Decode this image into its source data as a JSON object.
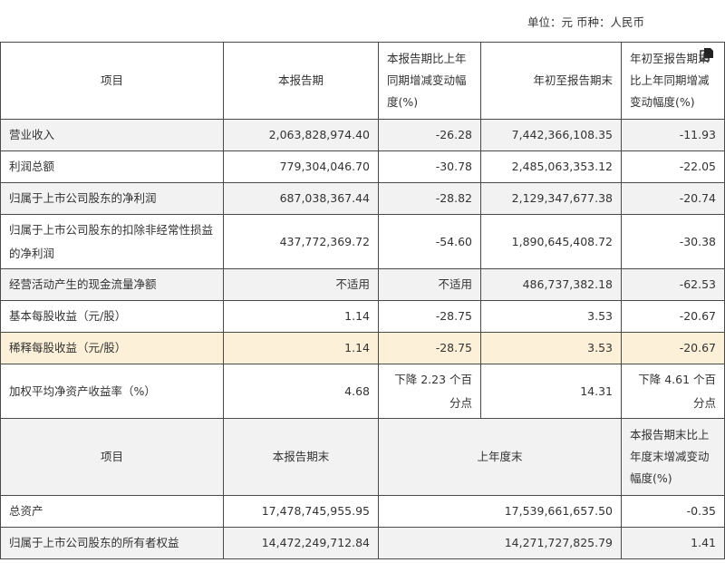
{
  "unit_label": "单位：元 币种：人民币",
  "header1": {
    "item": "项目",
    "current": "本报告期",
    "current_change": "本报告期比上年同期增减变动幅度(%)",
    "ytd": "年初至报告期末",
    "ytd_change": "年初至报告期末比上年同期增减变动幅度(%)"
  },
  "rows": [
    {
      "item": "营业收入",
      "current": "2,063,828,974.40",
      "current_change": "-26.28",
      "ytd": "7,442,366,108.35",
      "ytd_change": "-11.93"
    },
    {
      "item": "利润总额",
      "current": "779,304,046.70",
      "current_change": "-30.78",
      "ytd": "2,485,063,353.12",
      "ytd_change": "-22.05"
    },
    {
      "item": "归属于上市公司股东的净利润",
      "current": "687,038,367.44",
      "current_change": "-28.82",
      "ytd": "2,129,347,677.38",
      "ytd_change": "-20.74"
    },
    {
      "item": "归属于上市公司股东的扣除非经常性损益的净利润",
      "current": "437,772,369.72",
      "current_change": "-54.60",
      "ytd": "1,890,645,408.72",
      "ytd_change": "-30.38"
    },
    {
      "item": "经营活动产生的现金流量净额",
      "current": "不适用",
      "current_change": "不适用",
      "ytd": "486,737,382.18",
      "ytd_change": "-62.53"
    },
    {
      "item": "基本每股收益（元/股）",
      "current": "1.14",
      "current_change": "-28.75",
      "ytd": "3.53",
      "ytd_change": "-20.67"
    },
    {
      "item": "稀释每股收益（元/股）",
      "current": "1.14",
      "current_change": "-28.75",
      "ytd": "3.53",
      "ytd_change": "-20.67"
    },
    {
      "item": "加权平均净资产收益率（%）",
      "current": "4.68",
      "current_change": "下降 2.23 个百分点",
      "ytd": "14.31",
      "ytd_change": "下降 4.61 个百分点"
    }
  ],
  "header2": {
    "item": "项目",
    "period_end": "本报告期末",
    "last_year_end": "上年度末",
    "change": "本报告期末比上年度末增减变动幅度(%)"
  },
  "rows2": [
    {
      "item": "总资产",
      "period_end": "17,478,745,955.95",
      "last_year_end": "17,539,661,657.50",
      "change": "-0.35"
    },
    {
      "item": "归属于上市公司股东的所有者权益",
      "period_end": "14,472,249,712.84",
      "last_year_end": "14,271,727,825.79",
      "change": "1.41"
    }
  ]
}
